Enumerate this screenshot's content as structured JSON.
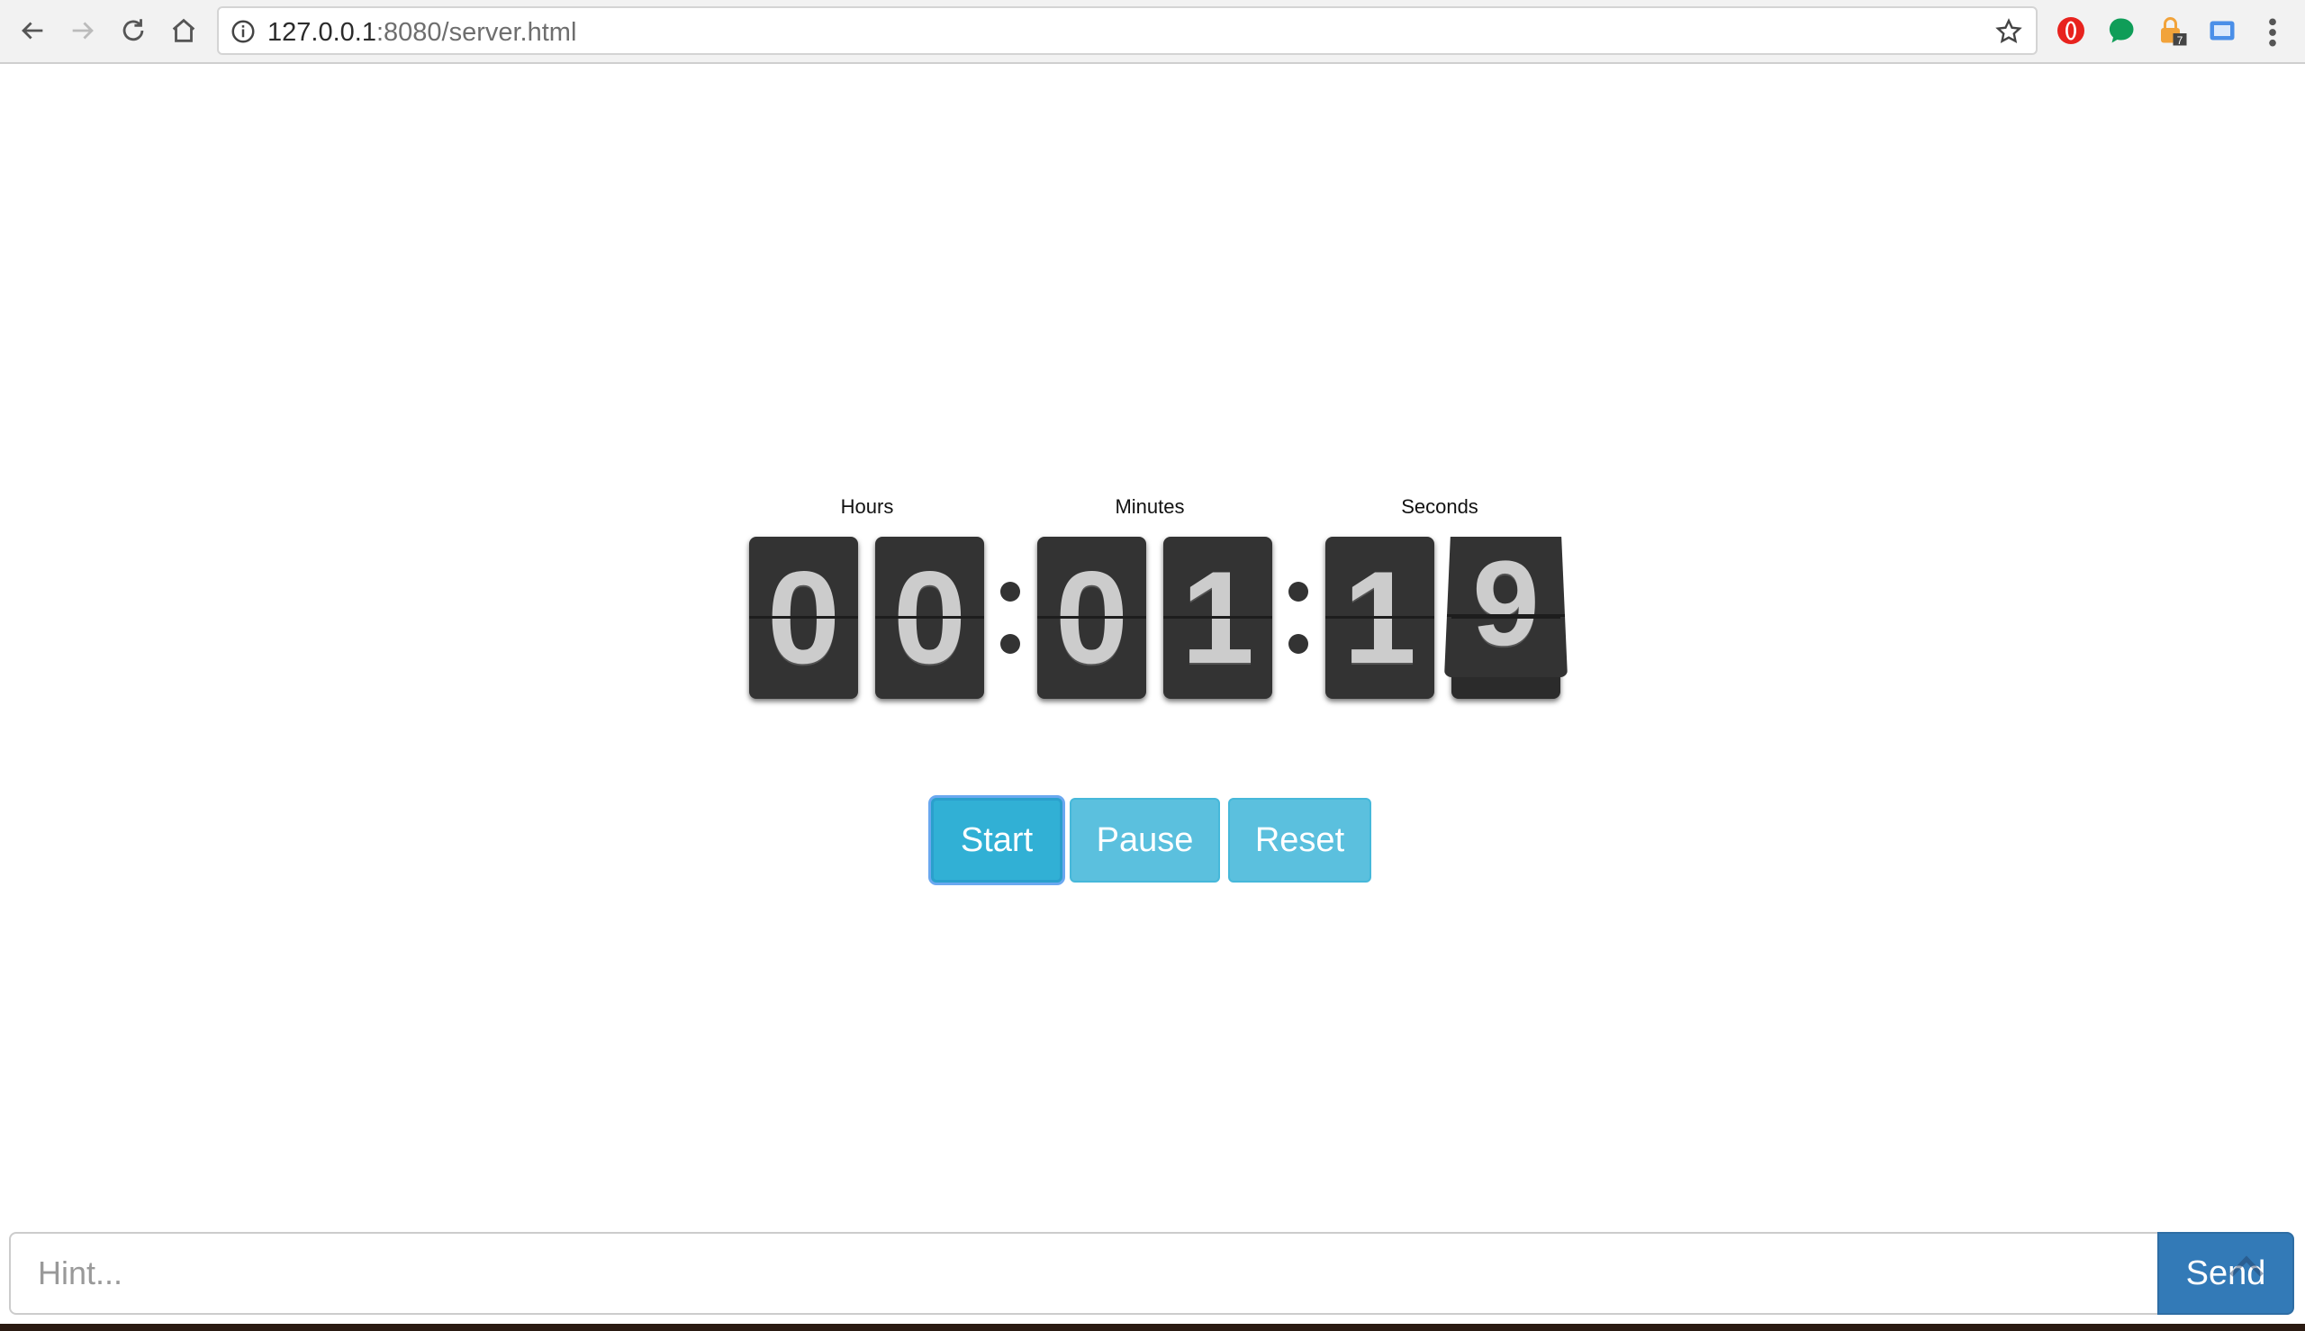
{
  "browser": {
    "url_host": "127.0.0.1",
    "url_rest": ":8080/server.html",
    "extension_badge": "7"
  },
  "clock": {
    "labels": [
      "Hours",
      "Minutes",
      "Seconds"
    ],
    "digits": [
      "0",
      "0",
      "0",
      "1",
      "1",
      "9"
    ]
  },
  "controls": {
    "start_label": "Start",
    "pause_label": "Pause",
    "reset_label": "Reset"
  },
  "hint": {
    "placeholder": "Hint...",
    "send_label": "Send"
  },
  "colors": {
    "card": "#333333",
    "digit_text": "#cccccc",
    "button_info": "#5bc0de",
    "button_primary": "#337ab7"
  }
}
